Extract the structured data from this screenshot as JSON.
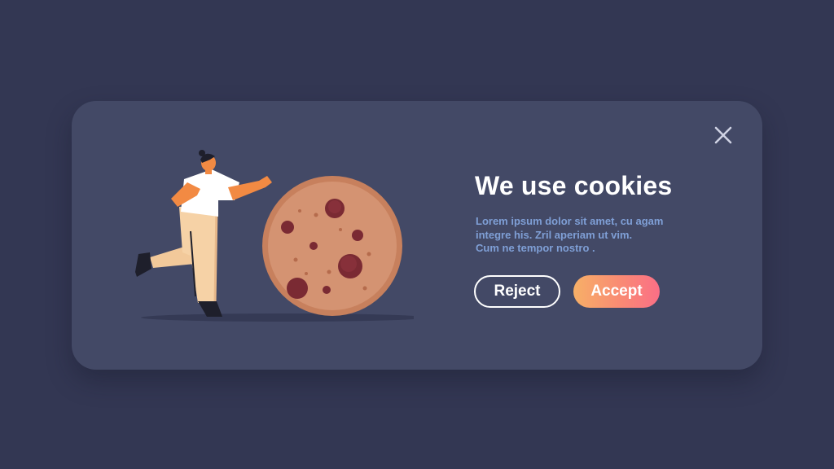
{
  "dialog": {
    "title": "We use cookies",
    "body_lines": [
      "Lorem ipsum dolor sit amet, cu agam",
      "integre his. Zril aperiam ut vim.",
      "Cum ne tempor nostro ."
    ],
    "reject_label": "Reject",
    "accept_label": "Accept",
    "close_icon": "close-icon"
  },
  "illustration": {
    "subject": "person-pushing-cookie",
    "icons": [
      "person-figure",
      "cookie-icon"
    ]
  },
  "colors": {
    "background": "#333753",
    "card": "#434966",
    "title": "#ffffff",
    "body_text": "#7f9fd6",
    "accept_gradient_start": "#f7b067",
    "accept_gradient_end": "#fa6f86",
    "cookie": "#c7805d",
    "cookie_chip": "#7a2a33"
  }
}
